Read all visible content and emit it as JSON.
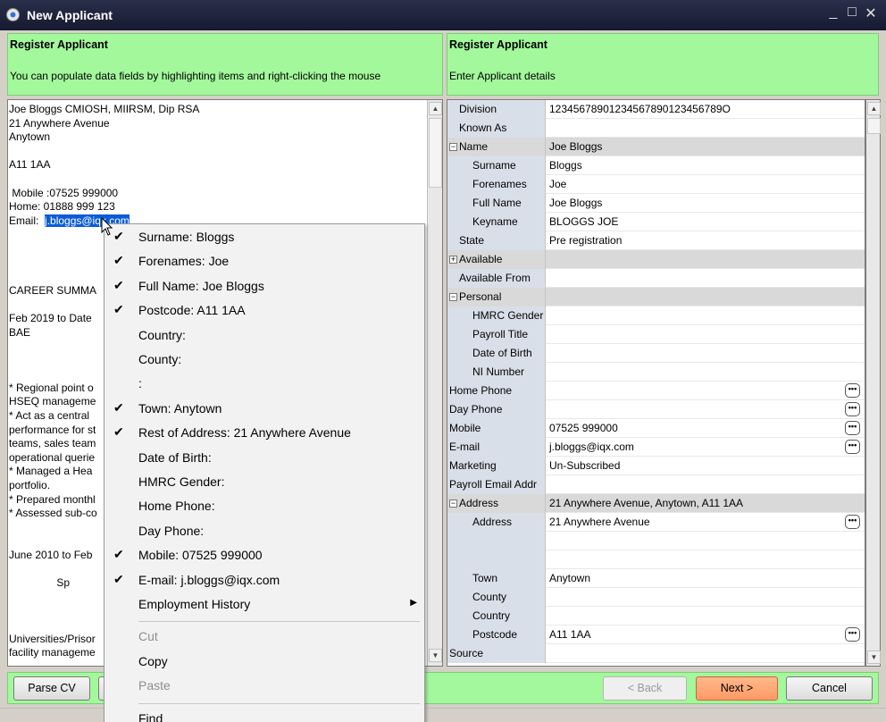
{
  "window": {
    "title": "New Applicant",
    "controls": [
      "_",
      "□",
      "✕"
    ]
  },
  "left_header": {
    "title": "Register Applicant",
    "subtitle": "You can populate data fields by highlighting items and right-clicking the mouse"
  },
  "right_header": {
    "title": "Register Applicant",
    "subtitle": "Enter Applicant details"
  },
  "cv_text": {
    "before_highlight": "Joe Bloggs CMIOSH, MIIRSM, Dip RSA\n21 Anywhere Avenue\nAnytown\n\nA11 1AA\n\n Mobile :07525 999000\nHome: 01888 999 123\nEmail:  ",
    "highlighted": "j.bloggs@iqx.com",
    "after_highlight": "\n\n\n\n\nCAREER SUMMA\n\nFeb 2019 to Date\nBAE\n\n\n\n* Regional point o\nHSEQ manageme\n* Act as a central\nperformance for st\nteams, sales team\noperational querie\n* Managed a Hea\nportfolio.\n* Prepared monthl\n* Assessed sub-co\n\n\nJune 2010 to Feb\n\n                Sp\n\n\n\nUniversities/Prisor\nfacility manageme"
  },
  "grid": {
    "rows": [
      {
        "label": "Division",
        "value": "12345678901234567890123456789O",
        "indent": 1,
        "type": "field",
        "ellipsis": false
      },
      {
        "label": "Known As",
        "value": "",
        "indent": 1,
        "type": "field",
        "ellipsis": false
      },
      {
        "label": "Name",
        "value": "Joe Bloggs",
        "indent": 0,
        "type": "group",
        "expander": "−",
        "ellipsis": false
      },
      {
        "label": "Surname",
        "value": "Bloggs",
        "indent": 2,
        "type": "field",
        "ellipsis": false
      },
      {
        "label": "Forenames",
        "value": "Joe",
        "indent": 2,
        "type": "field",
        "ellipsis": false
      },
      {
        "label": "Full Name",
        "value": "Joe Bloggs",
        "indent": 2,
        "type": "field",
        "ellipsis": false
      },
      {
        "label": "Keyname",
        "value": "BLOGGS JOE",
        "indent": 2,
        "type": "field",
        "ellipsis": false
      },
      {
        "label": "State",
        "value": "Pre registration",
        "indent": 1,
        "type": "field",
        "ellipsis": false
      },
      {
        "label": "Available",
        "value": "",
        "indent": 0,
        "type": "group",
        "expander": "+",
        "ellipsis": false
      },
      {
        "label": "Available From",
        "value": "",
        "indent": 1,
        "type": "field",
        "ellipsis": false
      },
      {
        "label": "Personal",
        "value": "",
        "indent": 0,
        "type": "group",
        "expander": "−",
        "ellipsis": false
      },
      {
        "label": "HMRC Gender",
        "value": "",
        "indent": 2,
        "type": "field",
        "ellipsis": false
      },
      {
        "label": "Payroll Title",
        "value": "",
        "indent": 2,
        "type": "field",
        "ellipsis": false
      },
      {
        "label": "Date of Birth",
        "value": "",
        "indent": 2,
        "type": "field",
        "ellipsis": false
      },
      {
        "label": "NI Number",
        "value": "",
        "indent": 2,
        "type": "field",
        "ellipsis": false
      },
      {
        "label": "Home Phone",
        "value": "",
        "indent": 0,
        "type": "field",
        "ellipsis": true
      },
      {
        "label": "Day Phone",
        "value": "",
        "indent": 0,
        "type": "field",
        "ellipsis": true
      },
      {
        "label": "Mobile",
        "value": "07525 999000",
        "indent": 0,
        "type": "field",
        "ellipsis": true
      },
      {
        "label": "E-mail",
        "value": "j.bloggs@iqx.com",
        "indent": 0,
        "type": "field",
        "ellipsis": true
      },
      {
        "label": "Marketing",
        "value": " Un-Subscribed",
        "indent": 0,
        "type": "field",
        "ellipsis": false
      },
      {
        "label": "Payroll Email Addr",
        "value": "",
        "indent": 0,
        "type": "field",
        "ellipsis": false
      },
      {
        "label": "Address",
        "value": "21 Anywhere Avenue, Anytown, A11 1AA",
        "indent": 0,
        "type": "group",
        "expander": "−",
        "ellipsis": false
      },
      {
        "label": "Address",
        "value": "21 Anywhere Avenue",
        "indent": 2,
        "type": "field",
        "ellipsis": true
      },
      {
        "label": "",
        "value": "",
        "indent": 2,
        "type": "field",
        "ellipsis": false
      },
      {
        "label": "",
        "value": "",
        "indent": 2,
        "type": "field",
        "ellipsis": false
      },
      {
        "label": "Town",
        "value": " Anytown",
        "indent": 2,
        "type": "field",
        "ellipsis": false
      },
      {
        "label": "County",
        "value": "",
        "indent": 2,
        "type": "field",
        "ellipsis": false
      },
      {
        "label": "Country",
        "value": "",
        "indent": 2,
        "type": "field",
        "ellipsis": false
      },
      {
        "label": "Postcode",
        "value": "A11 1AA",
        "indent": 2,
        "type": "field",
        "ellipsis": true
      },
      {
        "label": "Source",
        "value": "",
        "indent": 0,
        "type": "field",
        "ellipsis": false
      }
    ]
  },
  "context_menu": {
    "items": [
      {
        "label": "Surname: Bloggs",
        "checked": true
      },
      {
        "label": "Forenames: Joe",
        "checked": true
      },
      {
        "label": "Full Name: Joe Bloggs",
        "checked": true
      },
      {
        "label": "Postcode: A11 1AA",
        "checked": true
      },
      {
        "label": "Country:",
        "checked": false
      },
      {
        "label": "County:",
        "checked": false
      },
      {
        "label": ":",
        "checked": false
      },
      {
        "label": "Town: Anytown",
        "checked": true
      },
      {
        "label": "Rest of Address: 21 Anywhere Avenue",
        "checked": true
      },
      {
        "label": "Date of Birth:",
        "checked": false
      },
      {
        "label": "HMRC Gender:",
        "checked": false
      },
      {
        "label": "Home Phone:",
        "checked": false
      },
      {
        "label": "Day Phone:",
        "checked": false
      },
      {
        "label": "Mobile: 07525 999000",
        "checked": true
      },
      {
        "label": "E-mail: j.bloggs@iqx.com",
        "checked": true
      },
      {
        "label": "Employment History",
        "checked": false,
        "submenu": true
      },
      {
        "separator": true
      },
      {
        "label": "Cut",
        "checked": false,
        "disabled": true
      },
      {
        "label": "Copy",
        "checked": false
      },
      {
        "label": "Paste",
        "checked": false,
        "disabled": true
      },
      {
        "separator": true
      },
      {
        "label": "Find",
        "checked": false
      }
    ]
  },
  "buttons": {
    "parse_cv": "Parse CV",
    "back": "< Back",
    "next": "Next >",
    "cancel": "Cancel"
  },
  "colors": {
    "header_green": "#a3f89c",
    "highlight_blue": "#0a5cd6",
    "primary_button": "#ff9a66"
  }
}
